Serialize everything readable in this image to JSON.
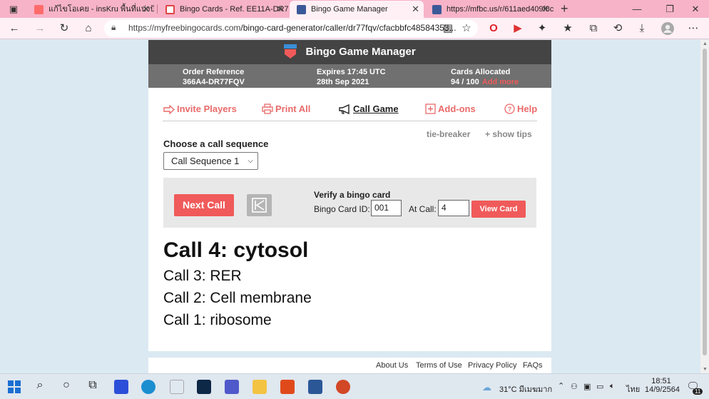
{
  "browser": {
    "tabs": [
      {
        "title": "แก้ไขโอเคย - insKru พื้นที่แบ่งปันไอเดีย",
        "active": false
      },
      {
        "title": "Bingo Cards - Ref. EE11A-DR77F",
        "active": false
      },
      {
        "title": "Bingo Game Manager",
        "active": true
      },
      {
        "title": "https://mfbc.us/r/611aed409f8c",
        "active": false
      }
    ],
    "url_host": "https://myfreebingocards.com",
    "url_path": "/bingo-card-generator/caller/dr77fqv/cfacbbfc48584353..."
  },
  "app": {
    "title": "Bingo Game Manager",
    "order_reference_label": "Order Reference",
    "order_reference_value": "366A4-DR77FQV",
    "expires_label": "Expires 17:45 UTC",
    "expires_value": "28th Sep 2021",
    "cards_label": "Cards Allocated",
    "cards_value": "94 / 100",
    "add_more": "Add more"
  },
  "nav": {
    "invite": "Invite Players",
    "print": "Print All",
    "call": "Call Game",
    "addons": "Add-ons",
    "help": "Help",
    "tie_breaker": "tie-breaker",
    "show_tips": "+ show tips"
  },
  "sequence": {
    "label": "Choose a call sequence",
    "selected": "Call Sequence 1"
  },
  "controls": {
    "next_call": "Next Call",
    "verify_title": "Verify a bingo card",
    "card_id_label": "Bingo Card ID:",
    "card_id_value": "001",
    "at_call_label": "At Call:",
    "at_call_value": "4",
    "view_card": "View Card"
  },
  "calls": {
    "current": "Call 4: cytosol",
    "previous": [
      "Call 3: RER",
      "Call 2: Cell membrane",
      "Call 1: ribosome"
    ]
  },
  "footer": {
    "about": "About Us",
    "terms": "Terms of Use",
    "privacy": "Privacy Policy",
    "faqs": "FAQs"
  },
  "taskbar": {
    "weather": "31°C  มีเมฆมาก",
    "lang": "ไทย",
    "time": "18:51",
    "date": "14/9/2564",
    "notifications": "11"
  },
  "colors": {
    "accent": "#f05a5a",
    "chrome": "#f7b3c8",
    "header": "#444444"
  }
}
